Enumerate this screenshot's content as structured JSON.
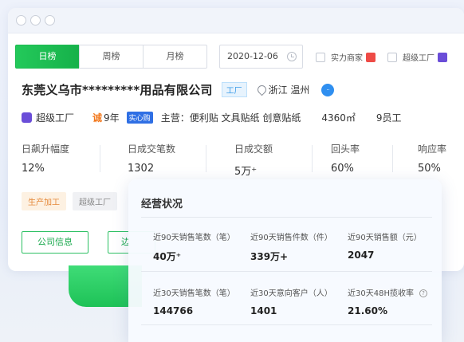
{
  "tabs": [
    {
      "label": "日榜",
      "active": true
    },
    {
      "label": "周榜",
      "active": false
    },
    {
      "label": "月榜",
      "active": false
    }
  ],
  "date_value": "2020-12-06",
  "filters": [
    {
      "label": "实力商家",
      "checked": false,
      "badge_icon": "strength-merchant-badge-icon"
    },
    {
      "label": "超级工厂",
      "checked": false,
      "badge_icon": "super-factory-badge-icon"
    }
  ],
  "company": {
    "name": "东莞义乌市*********用品有限公司",
    "type_tag": "工厂",
    "location": "浙江 温州",
    "chat_icon_text": "··"
  },
  "info": {
    "super_factory": "超级工厂",
    "cheng_icon": "诚",
    "years": "9年",
    "trust_tag": "实心购",
    "main_business": "主营：便利贴 文具贴纸 创意贴纸",
    "area": "4360㎡",
    "staff": "9员工"
  },
  "stats": [
    {
      "label": "日飙升幅度",
      "value": "12%"
    },
    {
      "label": "日成交笔数",
      "value": "1302"
    },
    {
      "label": "日成交额",
      "value": "5万⁺"
    },
    {
      "label": "回头率",
      "value": "60%"
    },
    {
      "label": "响应率",
      "value": "50%"
    }
  ],
  "tags": [
    "生产加工",
    "超级工厂"
  ],
  "buttons": {
    "company_info": "公司信息",
    "second_partial": "边"
  },
  "panel": {
    "title": "经营状况",
    "row1": [
      {
        "label": "近90天销售笔数（笔）",
        "value": "40万⁺"
      },
      {
        "label": "近90天销售件数（件）",
        "value": "339万+"
      },
      {
        "label": "近90天销售额（元）",
        "value": "2047"
      }
    ],
    "row2": [
      {
        "label": "近30天销售笔数（笔）",
        "value": "144766"
      },
      {
        "label": "近30天意向客户（人）",
        "value": "1401"
      },
      {
        "label": "近30天48H揽收率",
        "value": "21.60%"
      }
    ]
  },
  "colors": {
    "accent_green": "#1cbb50",
    "link_blue": "#2f8ff0",
    "super_factory_purple": "#6a4dd8",
    "cheng_orange": "#f2771a"
  }
}
